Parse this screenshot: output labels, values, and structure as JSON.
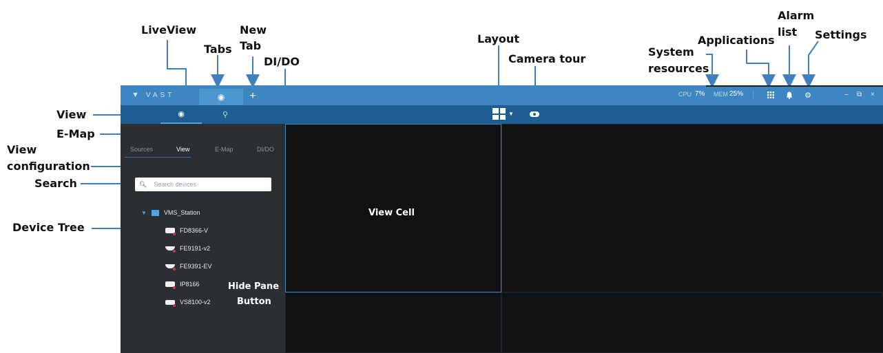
{
  "annotations": {
    "liveview": "LiveView",
    "tabs": "Tabs",
    "new_tab_1": "New",
    "new_tab_2": "Tab",
    "dido": "DI/DO",
    "layout": "Layout",
    "camera_tour": "Camera tour",
    "system_resources_1": "System",
    "system_resources_2": "resources",
    "applications": "Applications",
    "alarm_list_1": "Alarm",
    "alarm_list_2": "list",
    "settings": "Settings",
    "view": "View",
    "emap": "E-Map",
    "view_configuration_1": "View",
    "view_configuration_2": "configuration",
    "search": "Search",
    "device_tree": "Device Tree",
    "view_cell": "View Cell",
    "hide_pane_1": "Hide Pane",
    "hide_pane_2": "Button"
  },
  "app": {
    "logo_text": "VAST",
    "new_tab_symbol": "+",
    "system": {
      "cpu_label": "CPU",
      "cpu_value": "7%",
      "mem_label": "MEM",
      "mem_value": "25%"
    },
    "window_controls": [
      "–",
      "⧉",
      "×"
    ]
  },
  "sidebar": {
    "tabs": [
      "Sources",
      "View",
      "E-Map",
      "DI/DO"
    ],
    "active_tab": "View",
    "search_placeholder": "Search devices",
    "tree": {
      "root": "VMS_Station",
      "devices": [
        "FD8366-V",
        "FE9191-v2",
        "FE9391-EV",
        "IP8166",
        "VS8100-v2"
      ]
    }
  },
  "colors": {
    "topbar": "#3d86c1",
    "subbar": "#1e5d91",
    "sidebar": "#2b2e32",
    "accent": "#4ea3e0",
    "arrow": "#3f7fbf"
  }
}
